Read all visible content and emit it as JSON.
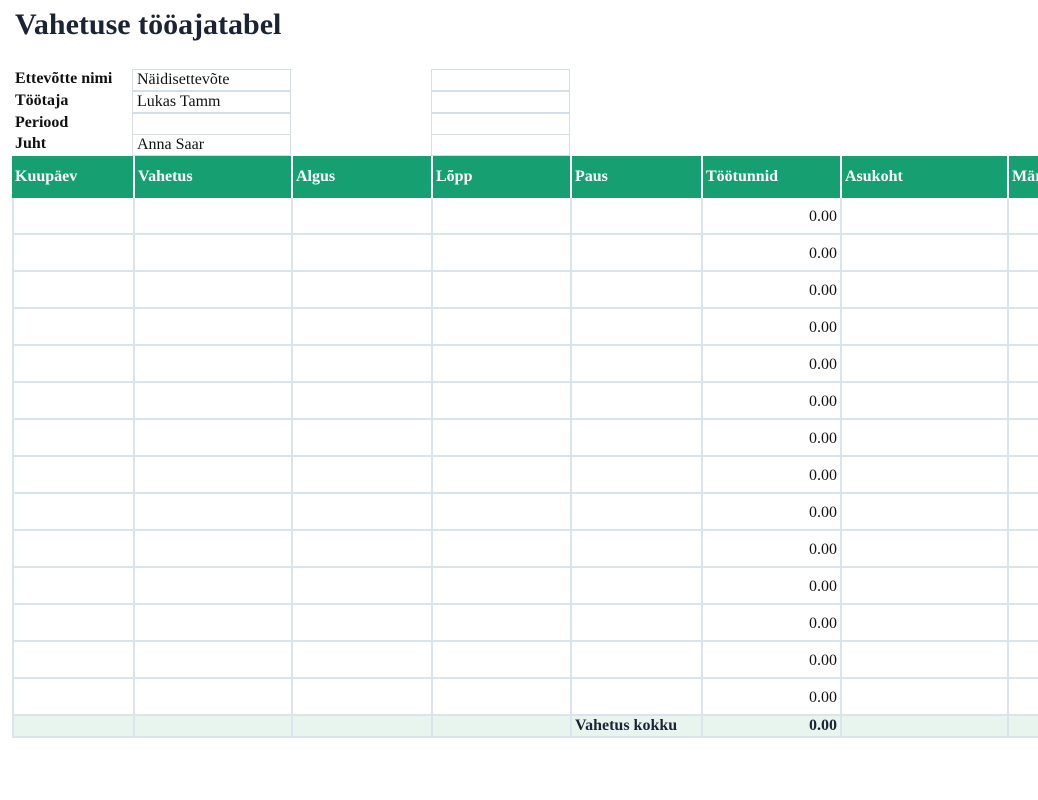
{
  "title": "Vahetuse tööajatabel",
  "info": {
    "company_label": "Ettevõtte nimi",
    "company_value": "Näidisettevõte",
    "employee_label": "Töötaja",
    "employee_value": "Lukas Tamm",
    "period_label": "Periood",
    "period_value": "",
    "manager_label": "Juht",
    "manager_value": "Anna Saar"
  },
  "table": {
    "headers": [
      "Kuupäev",
      "Vahetus",
      "Algus",
      "Lõpp",
      "Paus",
      "Töötunnid",
      "Asukoht",
      "Märkused"
    ],
    "rows": [
      {
        "hours": "0.00"
      },
      {
        "hours": "0.00"
      },
      {
        "hours": "0.00"
      },
      {
        "hours": "0.00"
      },
      {
        "hours": "0.00"
      },
      {
        "hours": "0.00"
      },
      {
        "hours": "0.00"
      },
      {
        "hours": "0.00"
      },
      {
        "hours": "0.00"
      },
      {
        "hours": "0.00"
      },
      {
        "hours": "0.00"
      },
      {
        "hours": "0.00"
      },
      {
        "hours": "0.00"
      },
      {
        "hours": "0.00"
      }
    ],
    "total_label": "Vahetus kokku",
    "total_value": "0.00"
  },
  "colors": {
    "header_bg": "#16a072",
    "total_row_bg": "#e8f5ef",
    "grid_line": "#dbe3eb"
  }
}
